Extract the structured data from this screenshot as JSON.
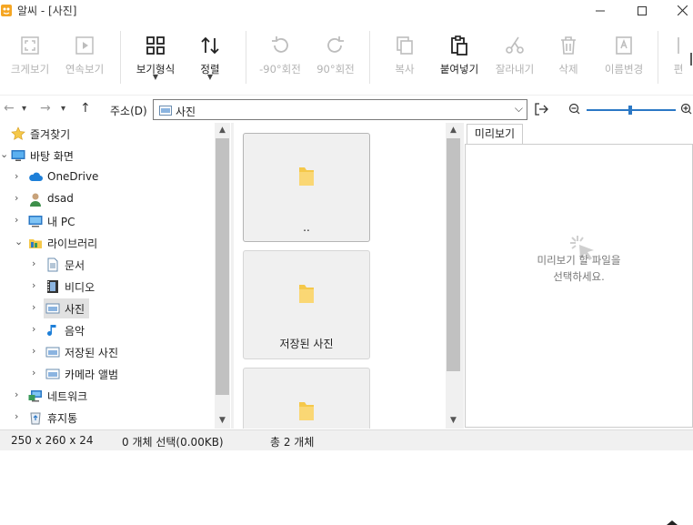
{
  "window": {
    "title": "알씨 - [사진]",
    "minimize": "—",
    "maximize": "☐",
    "close": "✕"
  },
  "toolbar": {
    "items": [
      {
        "label": "크게보기",
        "icon": "fullscreen-icon",
        "enabled": false
      },
      {
        "label": "연속보기",
        "icon": "slideshow-icon",
        "enabled": false
      },
      {
        "label": "보기형식",
        "icon": "view-grid-icon",
        "enabled": true,
        "dropdown": true
      },
      {
        "label": "정렬",
        "icon": "sort-icon",
        "enabled": true,
        "dropdown": true
      },
      {
        "label": "-90°회전",
        "icon": "rotate-left-icon",
        "enabled": false
      },
      {
        "label": "90°회전",
        "icon": "rotate-right-icon",
        "enabled": false
      },
      {
        "label": "복사",
        "icon": "copy-icon",
        "enabled": false
      },
      {
        "label": "붙여넣기",
        "icon": "paste-icon",
        "enabled": true
      },
      {
        "label": "잘라내기",
        "icon": "cut-icon",
        "enabled": false
      },
      {
        "label": "삭제",
        "icon": "trash-icon",
        "enabled": false
      },
      {
        "label": "이름변경",
        "icon": "rename-icon",
        "enabled": false
      },
      {
        "label": "편",
        "icon": "edit-icon",
        "enabled": false
      }
    ]
  },
  "address": {
    "back": "←",
    "forward": "→",
    "dropdown": "▾",
    "up": "↑",
    "label": "주소(D)",
    "value": "사진",
    "chevron": "⌵"
  },
  "tree": {
    "items": [
      {
        "label": "즐겨찾기",
        "icon": "star-icon",
        "expander": ""
      },
      {
        "label": "바탕 화면",
        "icon": "desktop-icon",
        "expander": "⌄"
      },
      {
        "label": "OneDrive",
        "icon": "cloud-icon",
        "expander": "›"
      },
      {
        "label": "dsad",
        "icon": "user-icon",
        "expander": "›"
      },
      {
        "label": "내 PC",
        "icon": "pc-icon",
        "expander": "›"
      },
      {
        "label": "라이브러리",
        "icon": "library-icon",
        "expander": "⌄"
      },
      {
        "label": "문서",
        "icon": "document-icon",
        "expander": "›"
      },
      {
        "label": "비디오",
        "icon": "video-icon",
        "expander": "›"
      },
      {
        "label": "사진",
        "icon": "picture-icon",
        "expander": "›",
        "selected": true
      },
      {
        "label": "음악",
        "icon": "music-icon",
        "expander": "›"
      },
      {
        "label": "저장된 사진",
        "icon": "picture-icon",
        "expander": "›"
      },
      {
        "label": "카메라 앨범",
        "icon": "picture-icon",
        "expander": "›"
      },
      {
        "label": "네트워크",
        "icon": "network-icon",
        "expander": "›"
      },
      {
        "label": "휴지통",
        "icon": "recycle-bin-icon",
        "expander": "›"
      }
    ]
  },
  "files": {
    "items": [
      {
        "name": "..",
        "icon": "folder-icon"
      },
      {
        "name": "저장된 사진",
        "icon": "folder-icon"
      },
      {
        "name": "",
        "icon": "folder-icon"
      }
    ]
  },
  "preview": {
    "tab": "미리보기",
    "message_line1": "미리보기 할 파일을",
    "message_line2": "선택하세요.",
    "icon": "loading-cursor-icon"
  },
  "status": {
    "dimensions": "250 x 260 x 24",
    "selection": "0 개체 선택(0.00KB)",
    "total": "총 2 개체"
  },
  "colors": {
    "folder": "#f5c84a",
    "folder_dark": "#e3ad2a",
    "accent": "#2b78c5"
  }
}
